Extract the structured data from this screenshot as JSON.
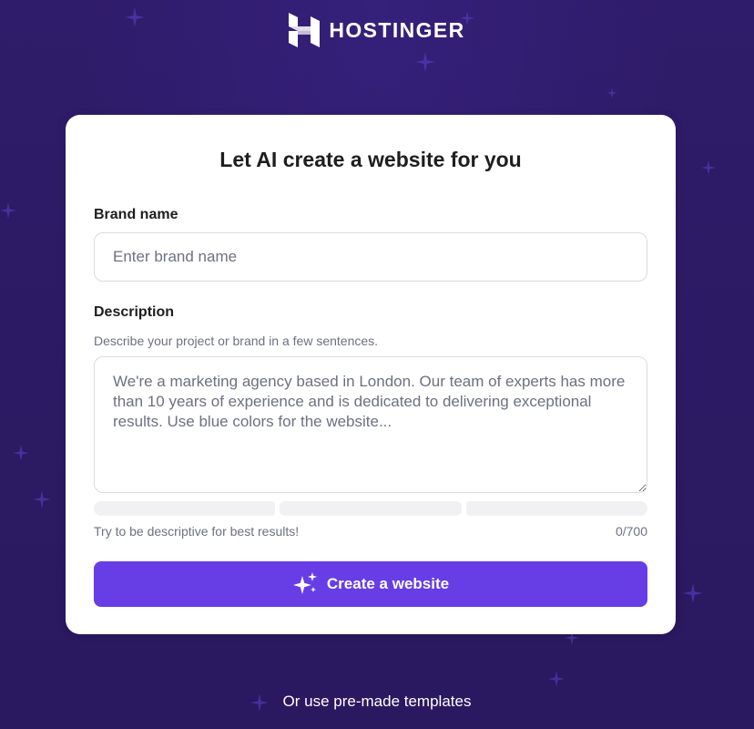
{
  "brand": {
    "name": "HOSTINGER",
    "icon": "hostinger-logo-icon"
  },
  "card": {
    "title": "Let AI create a website for you",
    "brand_name": {
      "label": "Brand name",
      "placeholder": "Enter brand name",
      "value": ""
    },
    "description": {
      "label": "Description",
      "hint": "Describe your project or brand in a few sentences.",
      "placeholder": "We're a marketing agency based in London. Our team of experts has more than 10 years of experience and is dedicated to delivering exceptional results. Use blue colors for the website...",
      "value": "",
      "progress_fraction": 0
    },
    "tip": "Try to be descriptive for best results!",
    "counter": "0/700",
    "button": {
      "label": "Create a website",
      "icon": "sparkles-icon"
    }
  },
  "footer": {
    "templates_link": "Or use pre-made templates"
  },
  "colors": {
    "background": "#2f1c6a",
    "accent": "#673de6",
    "card": "#ffffff",
    "muted_text": "#6d7081"
  }
}
